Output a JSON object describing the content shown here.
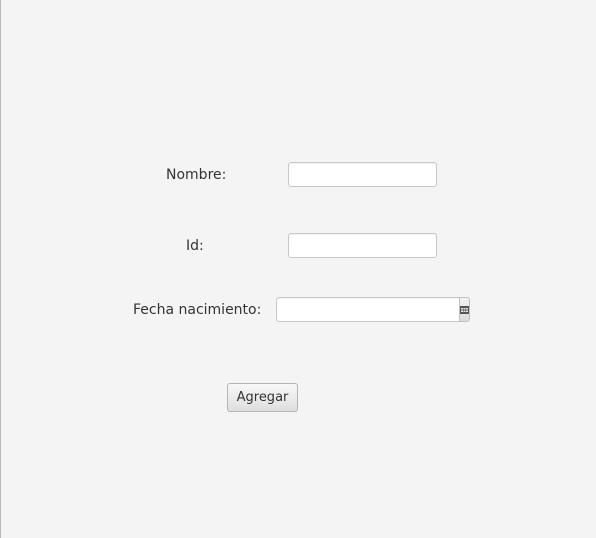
{
  "form": {
    "nombre_label": "Nombre:",
    "nombre_value": "",
    "id_label": "Id:",
    "id_value": "",
    "fecha_label": "Fecha nacimiento:",
    "fecha_value": "",
    "calendar_icon": "calendar-icon",
    "submit_label": "Agregar"
  },
  "colors": {
    "background": "#f4f4f4",
    "field_border": "#c8c8c8",
    "text": "#333333"
  }
}
